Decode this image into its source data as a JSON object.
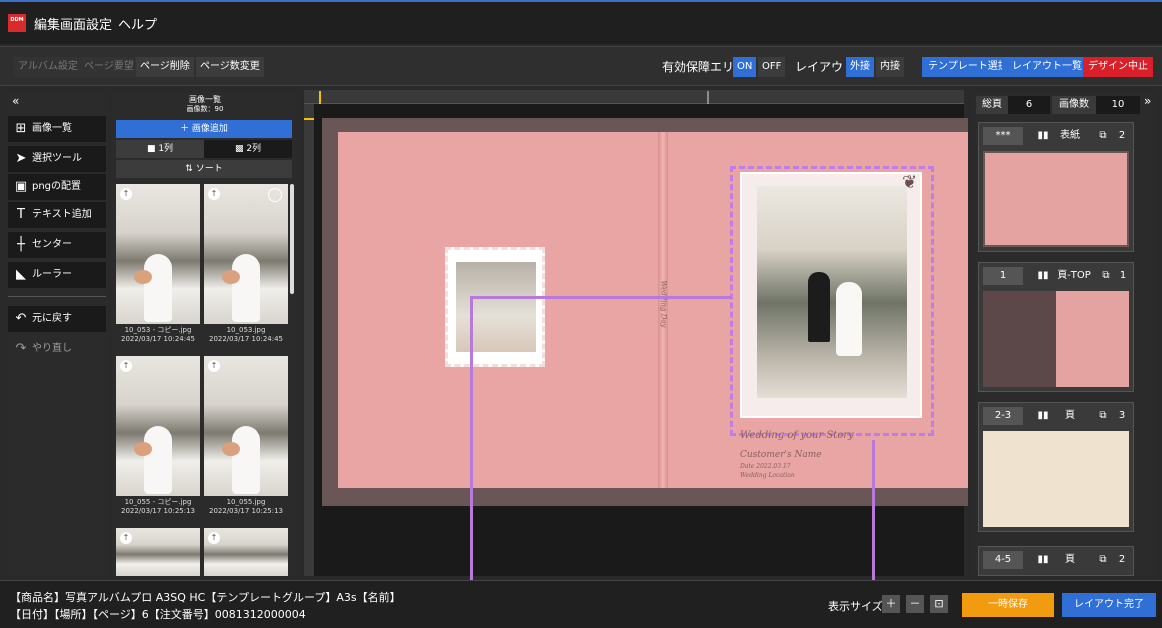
{
  "menubar": {
    "logo_text": "DDM",
    "items": [
      "編集画面設定",
      "ヘルプ"
    ]
  },
  "toolbar": {
    "album_settings": "アルバム設定",
    "page_request": "ページ要望",
    "page_delete": "ページ削除",
    "page_count_change": "ページ数変更",
    "safe_area_label": "有効保障エリア",
    "on": "ON",
    "off": "OFF",
    "layout_label": "レイアウト",
    "outer": "外接",
    "inner": "内接",
    "template_select": "テンプレート選択",
    "layout_list": "レイアウト一覧",
    "design_stop": "デザイン中止"
  },
  "tools": {
    "collapse": "«",
    "items": [
      {
        "icon": "grid-icon",
        "glyph": "⊞",
        "label": "画像一覧"
      },
      {
        "icon": "pointer-icon",
        "glyph": "➤",
        "label": "選択ツール"
      },
      {
        "icon": "image-icon",
        "glyph": "▣",
        "label": "pngの配置"
      },
      {
        "icon": "text-icon",
        "glyph": "T",
        "label": "テキスト追加"
      },
      {
        "icon": "center-icon",
        "glyph": "┼",
        "label": "センター"
      },
      {
        "icon": "ruler-icon",
        "glyph": "◣",
        "label": "ルーラー"
      },
      {
        "icon": "undo-icon",
        "glyph": "↶",
        "label": "元に戻す"
      },
      {
        "icon": "redo-icon",
        "glyph": "↷",
        "label": "やり直し"
      }
    ]
  },
  "images": {
    "title": "画像一覧",
    "count": "画像数：90",
    "add": "＋ 画像追加",
    "col1": "■ 1列",
    "col2": "▩ 2列",
    "sort": "⇅ ソート",
    "thumbs": [
      {
        "name": "10_053 - コピー.jpg",
        "date": "2022/03/17 10:24:45"
      },
      {
        "name": "10_053.jpg",
        "date": "2022/03/17 10:24:45"
      },
      {
        "name": "10_055 - コピー.jpg",
        "date": "2022/03/17 10:25:13"
      },
      {
        "name": "10_055.jpg",
        "date": "2022/03/17 10:25:13"
      }
    ]
  },
  "canvas": {
    "script_left": "Wedding Day",
    "title_script": "Wedding of your Story",
    "customer": "Customer's Name",
    "sub1": "Date 2022.03.17",
    "sub2": "Wedding Location"
  },
  "pages": {
    "expand": "»",
    "total_label": "総頁",
    "total": "6",
    "image_count_label": "画像数",
    "image_count": "10",
    "cards": [
      {
        "id": "***",
        "type": "表紙",
        "count": "2"
      },
      {
        "id": "1",
        "type": "頁-TOP",
        "count": "1"
      },
      {
        "id": "2-3",
        "type": "頁",
        "count": "3"
      },
      {
        "id": "4-5",
        "type": "頁",
        "count": "2"
      }
    ]
  },
  "status": {
    "line1": "【商品名】写真アルバムプロ A3SQ HC【テンプレートグループ】A3s【名前】",
    "line2": "【日付】【場所】【ページ】6【注文番号】0081312000004",
    "display_size": "表示サイズ",
    "plus": "＋",
    "minus": "－",
    "fit": "⊡",
    "temp_save": "一時保存",
    "layout_done": "レイアウト完了"
  },
  "colors": {
    "accent": "#2f6fd6",
    "danger": "#d9202a",
    "save": "#f29b0e",
    "selection": "#c07de8",
    "page_pink": "#e8a5a3"
  }
}
